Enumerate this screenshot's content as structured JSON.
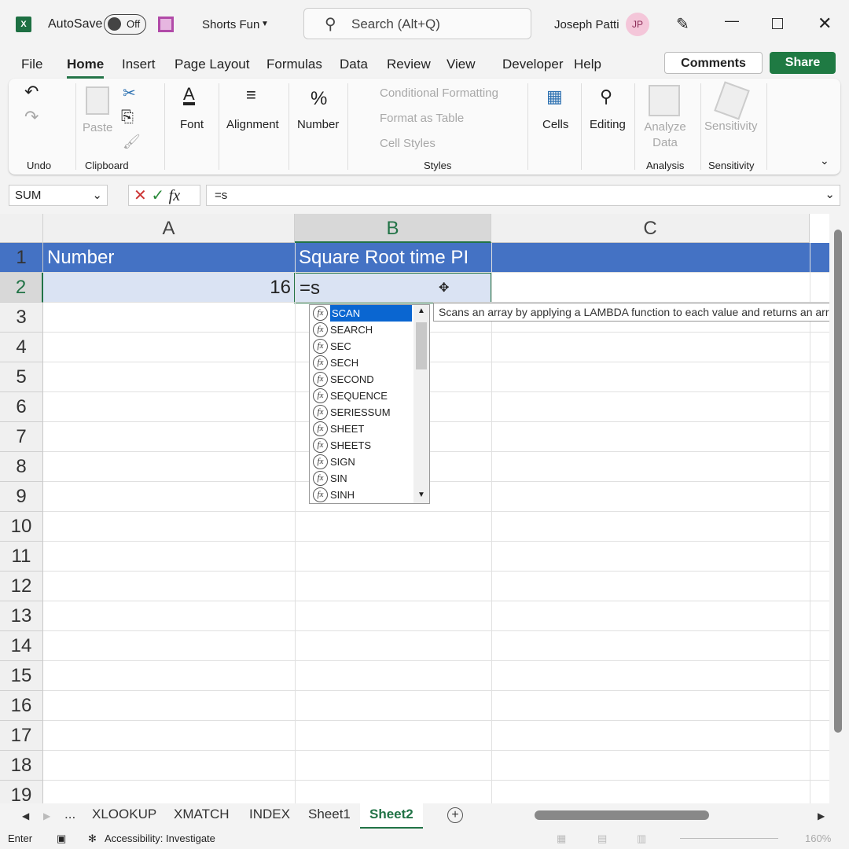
{
  "titlebar": {
    "app_icon": "excel-icon",
    "autosave_label": "AutoSave",
    "autosave_state": "Off",
    "save_icon": "save-icon",
    "filename": "Shorts Fun",
    "search_placeholder": "Search (Alt+Q)",
    "user_name": "Joseph Patti",
    "user_initials": "JP"
  },
  "menu": [
    "File",
    "Home",
    "Insert",
    "Page Layout",
    "Formulas",
    "Data",
    "Review",
    "View",
    "Developer",
    "Help"
  ],
  "active_menu": "Home",
  "buttons": {
    "comments": "Comments",
    "share": "Share"
  },
  "ribbon": {
    "paste": "Paste",
    "font": "Font",
    "alignment": "Alignment",
    "number": "Number",
    "conditional_formatting": "Conditional Formatting",
    "format_as_table": "Format as Table",
    "cell_styles": "Cell Styles",
    "cells": "Cells",
    "editing": "Editing",
    "analyze_data": "Analyze Data",
    "sensitivity": "Sensitivity",
    "groups": {
      "undo": "Undo",
      "clipboard": "Clipboard",
      "styles": "Styles",
      "analysis": "Analysis",
      "sensitivity": "Sensitivity"
    }
  },
  "formula_bar": {
    "name_box": "SUM",
    "value": "=s"
  },
  "columns": [
    "A",
    "B",
    "C"
  ],
  "rows": [
    "1",
    "2",
    "3",
    "4",
    "5",
    "6",
    "7",
    "8",
    "9",
    "10",
    "11",
    "12",
    "13",
    "14",
    "15",
    "16",
    "17",
    "18",
    "19"
  ],
  "cells": {
    "A1": "Number",
    "B1": "Square Root time PI",
    "A2": "16",
    "B2": "=s"
  },
  "autocomplete": {
    "selected": "SCAN",
    "items": [
      "SCAN",
      "SEARCH",
      "SEC",
      "SECH",
      "SECOND",
      "SEQUENCE",
      "SERIESSUM",
      "SHEET",
      "SHEETS",
      "SIGN",
      "SIN",
      "SINH"
    ],
    "tooltip": "Scans an array by applying a LAMBDA function to each value and returns an array"
  },
  "sheet_tabs": {
    "more": "...",
    "tabs": [
      "XLOOKUP",
      "XMATCH",
      "INDEX",
      "Sheet1",
      "Sheet2"
    ],
    "active": "Sheet2"
  },
  "status": {
    "mode": "Enter",
    "accessibility": "Accessibility: Investigate",
    "zoom": "160%"
  },
  "colors": {
    "accent": "#217346",
    "header_fill": "#4472c4",
    "row2_fill": "#dae3f3",
    "selection": "#0a66d1"
  }
}
